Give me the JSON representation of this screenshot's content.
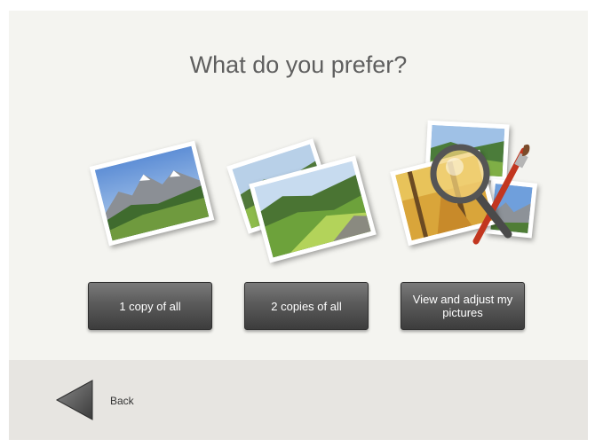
{
  "heading": "What do you prefer?",
  "options": [
    {
      "label": "1 copy of all"
    },
    {
      "label": "2 copies of all"
    },
    {
      "label": "View and adjust my pictures"
    }
  ],
  "footer": {
    "back_label": "Back"
  },
  "colors": {
    "background": "#f4f4f0",
    "footer": "#e7e5e1",
    "button": "#4f4f4f",
    "title": "#5f5f5f"
  }
}
